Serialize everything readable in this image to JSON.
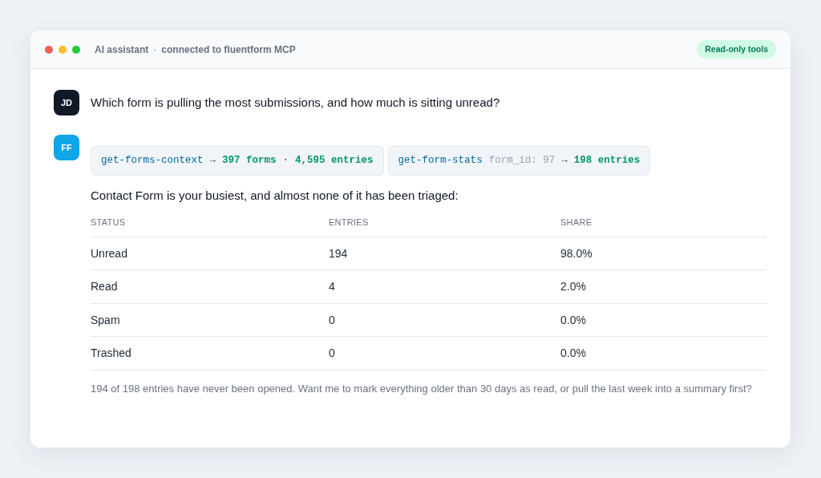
{
  "window": {
    "title": "AI assistant",
    "separator": "·",
    "subtitle": "connected to fluentform MCP",
    "badge": "Read-only tools"
  },
  "messages": [
    {
      "kind": "user",
      "avatar": "JD",
      "text": "Which form is pulling the most submissions, and how much is sitting unread?"
    },
    {
      "kind": "assistant",
      "avatar": "FF",
      "tool_calls": [
        {
          "parts": [
            {
              "kind": "tool",
              "text": "get-forms-context"
            },
            {
              "kind": "sep",
              "text": "→"
            },
            {
              "kind": "result",
              "text": "397 forms"
            },
            {
              "kind": "sep",
              "text": "·"
            },
            {
              "kind": "result",
              "text": "4,595 entries"
            }
          ]
        },
        {
          "parts": [
            {
              "kind": "tool",
              "text": "get-form-stats"
            },
            {
              "kind": "arg",
              "text": "form_id: 97"
            },
            {
              "kind": "sep",
              "text": "→"
            },
            {
              "kind": "result",
              "text": "198 entries"
            }
          ]
        }
      ],
      "intro": "Contact Form is your busiest, and almost none of it has been triaged:",
      "table": {
        "columns": [
          "STATUS",
          "ENTRIES",
          "SHARE"
        ],
        "rows": [
          [
            "Unread",
            "194",
            "98.0%"
          ],
          [
            "Read",
            "4",
            "2.0%"
          ],
          [
            "Spam",
            "0",
            "0.0%"
          ],
          [
            "Trashed",
            "0",
            "0.0%"
          ]
        ]
      },
      "followup": "194 of 198 entries have never been opened. Want me to mark everything older than 30 days as read, or pull the last week into a summary first?"
    }
  ]
}
